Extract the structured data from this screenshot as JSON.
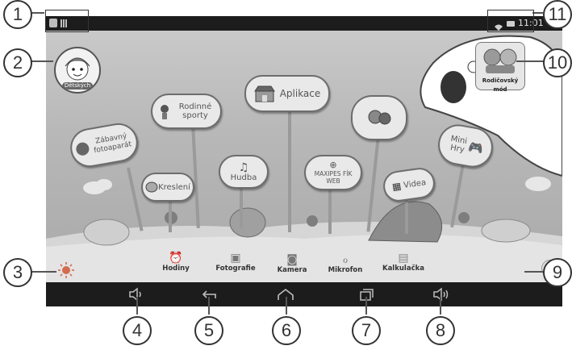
{
  "callouts": [
    "1",
    "2",
    "3",
    "4",
    "5",
    "6",
    "7",
    "8",
    "9",
    "10",
    "11"
  ],
  "status_bar": {
    "time": "11:01"
  },
  "header": {
    "kids_label": "Dětských",
    "parent_mode_label": "Rodičovský mód"
  },
  "apps": [
    {
      "label": "Aplikace"
    },
    {
      "label": "Rodinné sporty"
    },
    {
      "label": "Zábavný fotoaparát"
    },
    {
      "label": "Kreslení"
    },
    {
      "label": "Hudba"
    },
    {
      "label": "MAXIPES FÍK WEB"
    },
    {
      "label": "Videa"
    },
    {
      "label": "Mini Hry"
    }
  ],
  "dock": [
    {
      "label": "Hodiny",
      "icon": "alarm-clock-icon"
    },
    {
      "label": "Fotografie",
      "icon": "photos-icon"
    },
    {
      "label": "Kamera",
      "icon": "camera-icon"
    },
    {
      "label": "Mikrofon",
      "icon": "microphone-icon"
    },
    {
      "label": "Kalkulačka",
      "icon": "calculator-icon"
    }
  ]
}
